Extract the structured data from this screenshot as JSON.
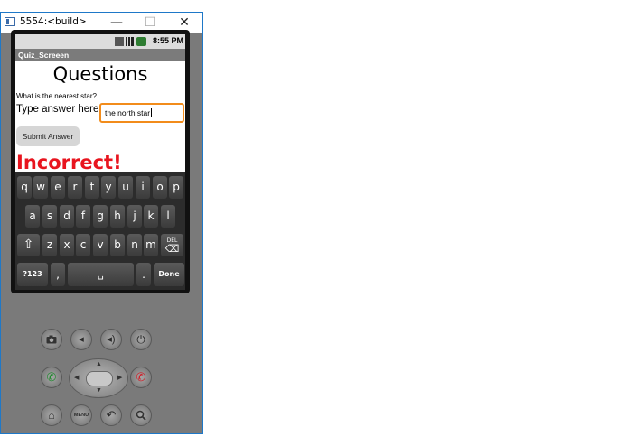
{
  "window": {
    "title": "5554:<build>",
    "min": "—",
    "max": "☐",
    "close": "✕"
  },
  "status": {
    "time": "8:55 PM"
  },
  "app": {
    "title": "Quiz_Screeen",
    "heading": "Questions",
    "question": "What is the nearest star?",
    "answer_label": "Type answer here:",
    "answer_value": "the north star",
    "submit_label": "Submit Answer",
    "result": "Incorrect!",
    "result_color": "#e8141e"
  },
  "keyboard": {
    "row1": [
      "q",
      "w",
      "e",
      "r",
      "t",
      "y",
      "u",
      "i",
      "o",
      "p"
    ],
    "row2": [
      "a",
      "s",
      "d",
      "f",
      "g",
      "h",
      "j",
      "k",
      "l"
    ],
    "row3": [
      "z",
      "x",
      "c",
      "v",
      "b",
      "n",
      "m"
    ],
    "shift": "⇧",
    "del": "DEL",
    "sym": "?123",
    "comma": ",",
    "space": "␣",
    "period": ".",
    "done": "Done"
  },
  "hardware": {
    "camera": "camera-icon",
    "vol_down": "volume-down-icon",
    "vol_up": "volume-up-icon",
    "power": "power-icon",
    "call": "call-icon",
    "end_call": "end-call-icon",
    "home": "home-icon",
    "menu": "MENU",
    "back": "back-icon",
    "search": "search-icon"
  }
}
